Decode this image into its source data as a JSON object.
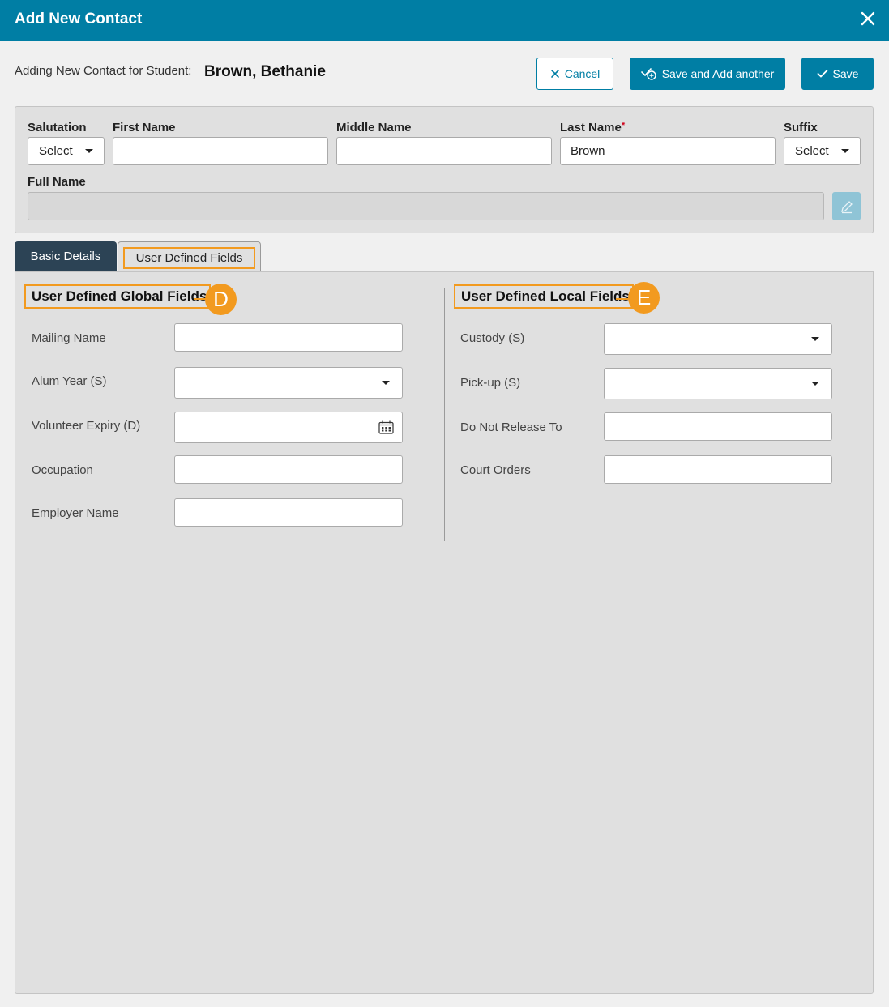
{
  "dialog": {
    "title": "Add New Contact"
  },
  "header": {
    "subhead_label": "Adding New Contact for Student:",
    "student_name": "Brown, Bethanie",
    "cancel_label": "Cancel",
    "save_add_label": "Save and Add another",
    "save_label": "Save"
  },
  "name_fields": {
    "salutation": {
      "label": "Salutation",
      "value": "Select"
    },
    "first_name": {
      "label": "First Name",
      "value": ""
    },
    "middle_name": {
      "label": "Middle Name",
      "value": ""
    },
    "last_name": {
      "label": "Last Name",
      "required_marker": "*",
      "value": "Brown"
    },
    "suffix": {
      "label": "Suffix",
      "value": "Select"
    },
    "full_name": {
      "label": "Full Name",
      "value": ""
    }
  },
  "tabs": [
    {
      "label": "Basic Details",
      "active": false
    },
    {
      "label": "User Defined Fields",
      "active": true
    }
  ],
  "global_section": {
    "title": "User Defined Global Fields",
    "badge": "D",
    "fields": [
      {
        "label": "Mailing Name",
        "type": "text"
      },
      {
        "label": "Alum Year (S)",
        "type": "select"
      },
      {
        "label": "Volunteer Expiry (D)",
        "type": "date"
      },
      {
        "label": "Occupation",
        "type": "text"
      },
      {
        "label": "Employer Name",
        "type": "text"
      }
    ]
  },
  "local_section": {
    "title": "User Defined Local Fields",
    "badge": "E",
    "fields": [
      {
        "label": "Custody (S)",
        "type": "select"
      },
      {
        "label": "Pick-up (S)",
        "type": "select"
      },
      {
        "label": "Do Not Release To",
        "type": "text"
      },
      {
        "label": "Court Orders",
        "type": "text"
      }
    ]
  },
  "colors": {
    "header": "#007ea4",
    "active_tab": "#2c4355",
    "highlight": "#f29a1f",
    "panel": "#e0e0e0"
  },
  "icons": [
    "close-icon",
    "x-icon",
    "add-check-icon",
    "check-icon",
    "caret-down-icon",
    "pencil-icon",
    "calendar-icon"
  ]
}
